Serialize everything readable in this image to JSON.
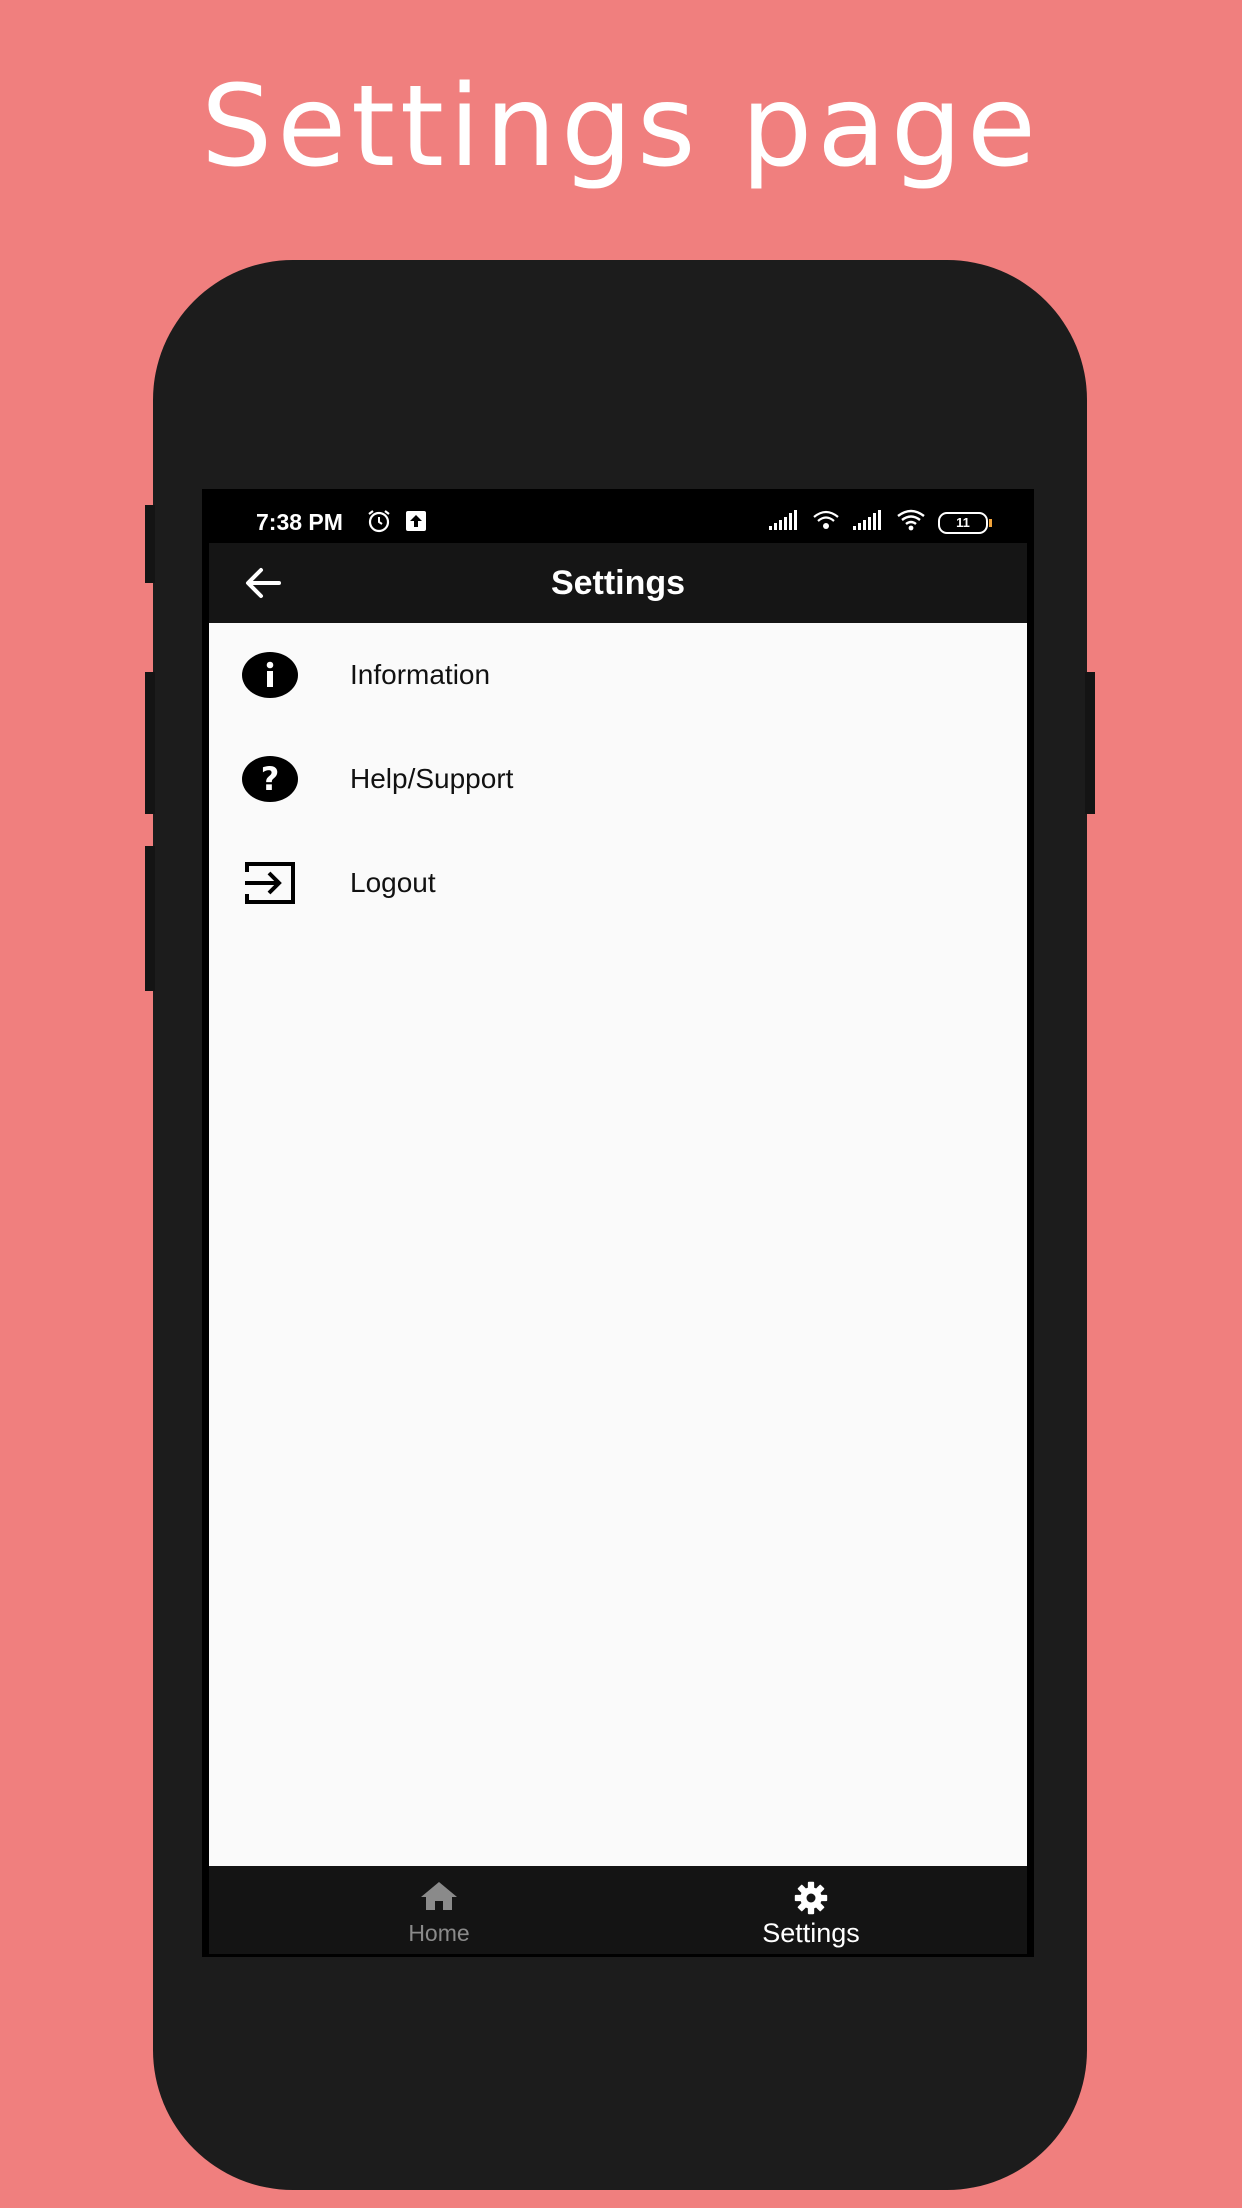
{
  "promo": {
    "title": "Settings page"
  },
  "statusbar": {
    "time": "7:38 PM",
    "battery": "11",
    "left_icons": [
      "alarm-icon",
      "upload-icon"
    ],
    "right_icons": [
      "signal-icon",
      "hotspot-icon",
      "signal-icon",
      "wifi-icon",
      "battery-icon"
    ]
  },
  "appbar": {
    "title": "Settings",
    "back_icon": "arrow-left-icon"
  },
  "settings": {
    "items": [
      {
        "label": "Information",
        "icon": "info-icon"
      },
      {
        "label": "Help/Support",
        "icon": "help-icon"
      },
      {
        "label": "Logout",
        "icon": "logout-icon"
      }
    ]
  },
  "bottom_nav": {
    "home": {
      "label": "Home",
      "icon": "home-icon",
      "active": false
    },
    "settings": {
      "label": "Settings",
      "icon": "gear-icon",
      "active": true
    }
  },
  "colors": {
    "background": "#f07f7e",
    "phone_body": "#1c1c1c",
    "appbar": "#151515",
    "content": "#fafafa",
    "nav_inactive": "#8a8a8a",
    "nav_active": "#ffffff"
  }
}
